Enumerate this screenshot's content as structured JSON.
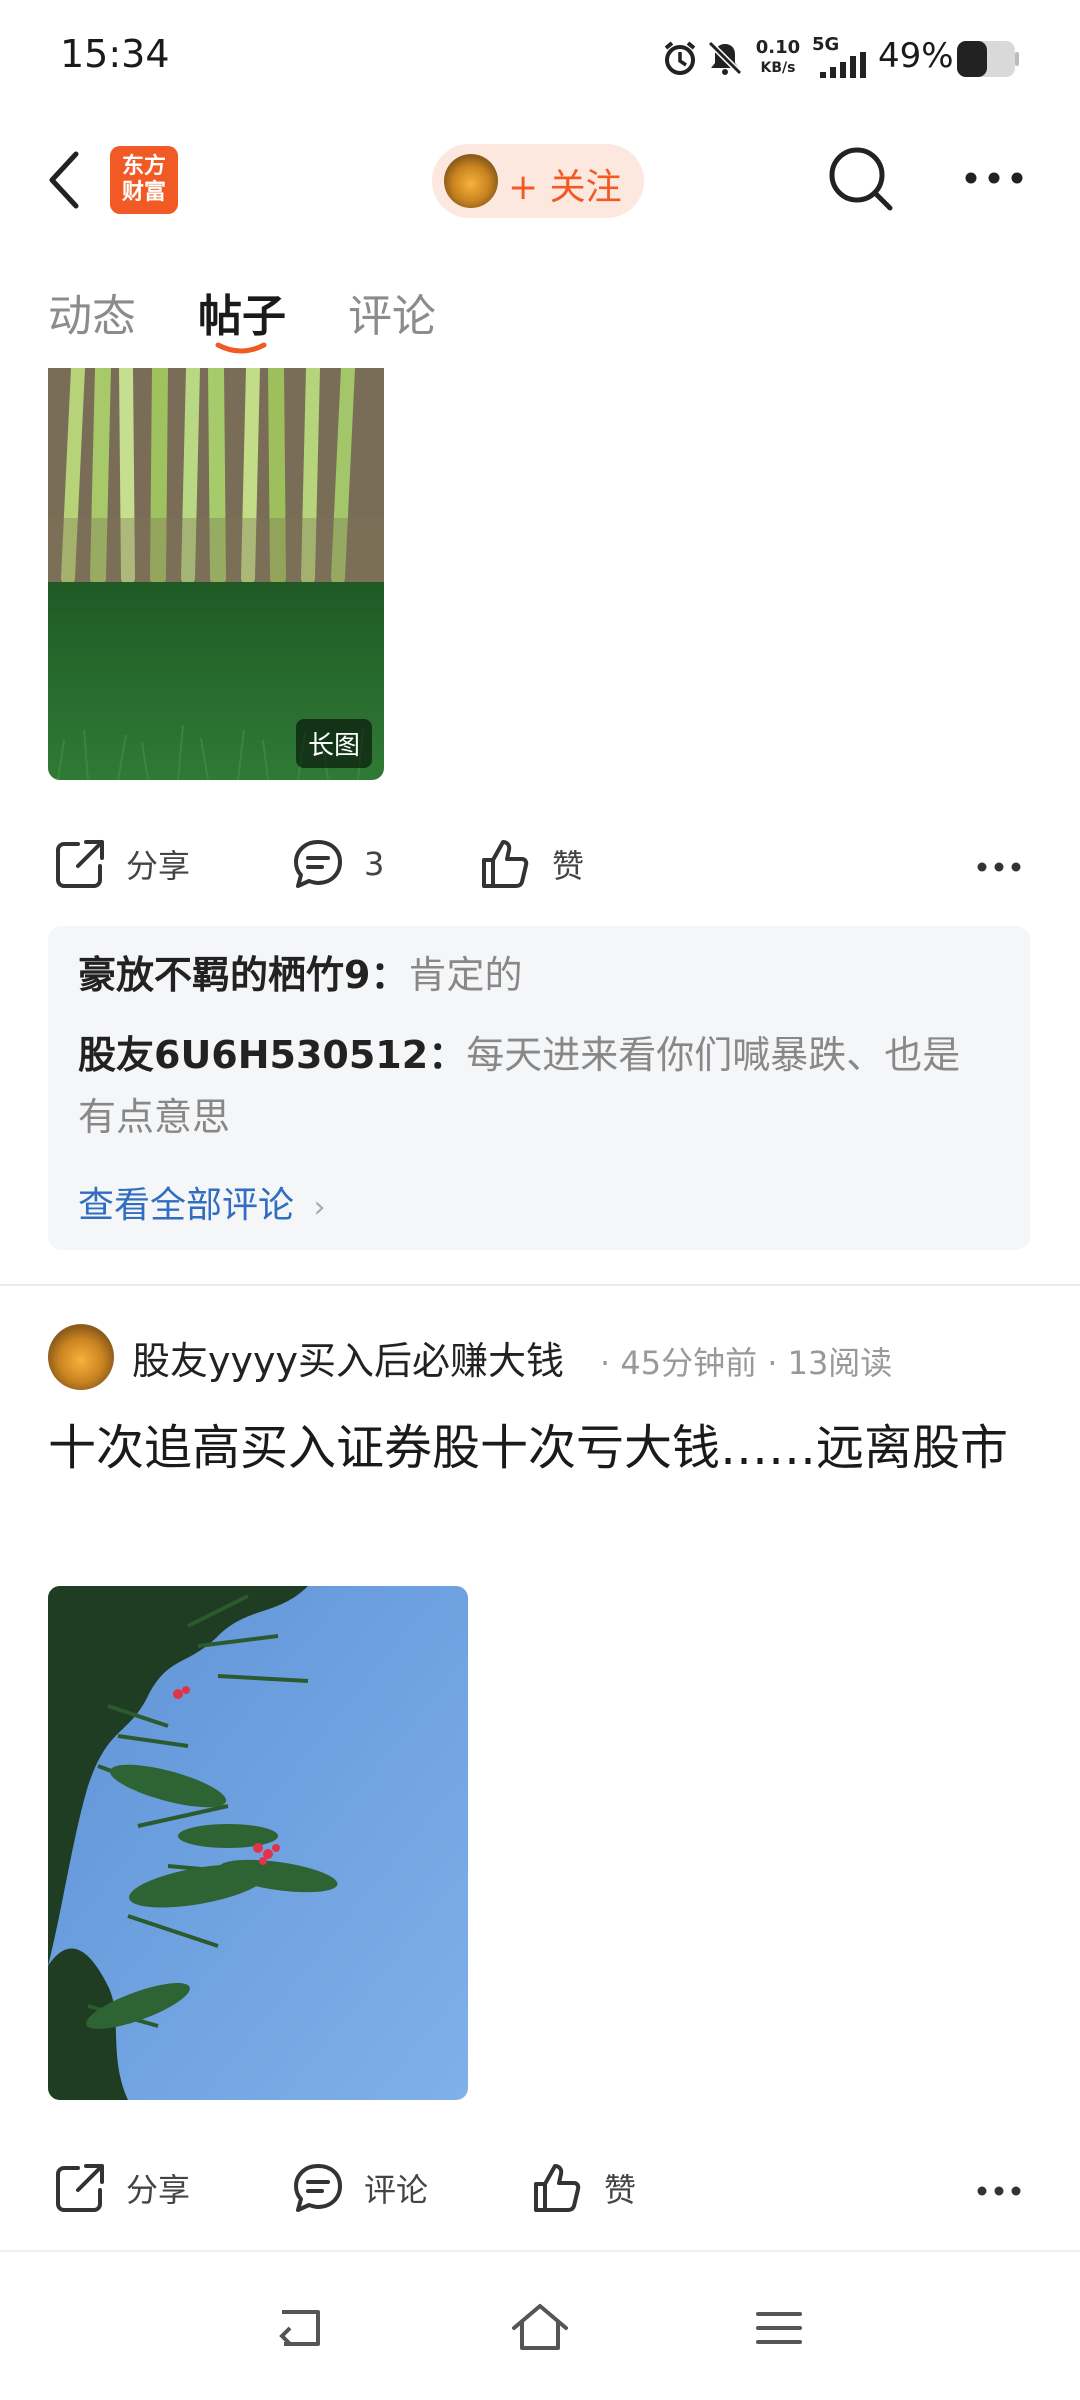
{
  "status_bar": {
    "time": "15:34",
    "net_speed_value": "0.10",
    "net_speed_unit": "KB/s",
    "network_type": "5G",
    "battery": "49%"
  },
  "header": {
    "logo_line1": "东方",
    "logo_line2": "财富",
    "follow_label": "+ 关注"
  },
  "tabs": [
    {
      "label": "动态"
    },
    {
      "label": "帖子"
    },
    {
      "label": "评论"
    }
  ],
  "post1": {
    "image_badge": "长图",
    "actions": {
      "share": "分享",
      "comment_count": "3",
      "like": "赞"
    },
    "comments": [
      {
        "user": "豪放不羁的栖竹9",
        "text": "肯定的"
      },
      {
        "user": "股友6U6H530512",
        "text": "每天进来看你们喊暴跌、也是有点意思"
      }
    ],
    "view_all": "查看全部评论"
  },
  "post2": {
    "author": "股友yyyy买入后必赚大钱",
    "meta": "· 45分钟前 · 13阅读",
    "title": "十次追高买入证券股十次亏大钱……远离股市",
    "actions": {
      "share": "分享",
      "comment": "评论",
      "like": "赞"
    }
  },
  "colors": {
    "accent": "#f15a24",
    "link": "#2f6ec0",
    "comment_bg": "#f5f6f8"
  }
}
